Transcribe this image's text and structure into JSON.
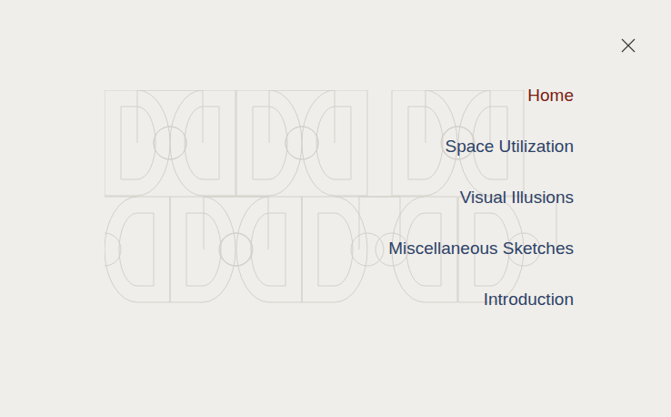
{
  "menu": {
    "items": [
      {
        "label": "Home",
        "selected": true
      },
      {
        "label": "Space Utilization",
        "selected": false
      },
      {
        "label": "Visual Illusions",
        "selected": false
      },
      {
        "label": "Miscellaneous Sketches",
        "selected": false
      },
      {
        "label": "Introduction",
        "selected": false
      }
    ]
  }
}
